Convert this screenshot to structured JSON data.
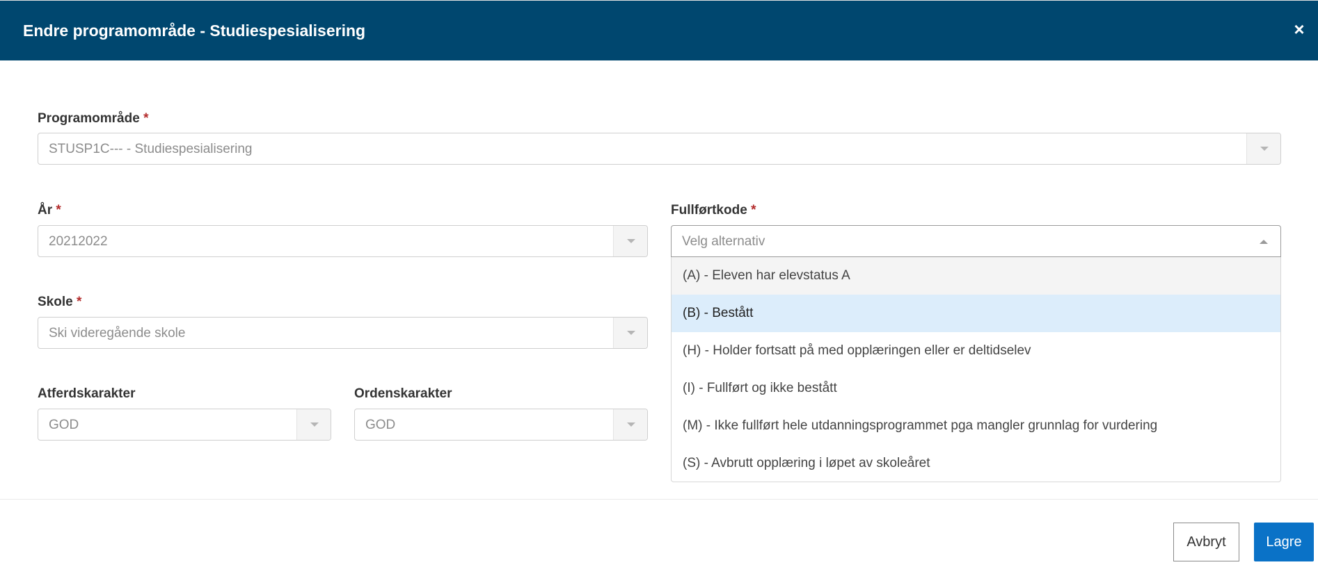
{
  "dialog": {
    "title": "Endre programområde - Studiespesialisering",
    "close_symbol": "×"
  },
  "form": {
    "required_mark": "*",
    "programomrade": {
      "label": "Programområde",
      "value": "STUSP1C--- - Studiespesialisering"
    },
    "ar": {
      "label": "År",
      "value": "20212022"
    },
    "skole": {
      "label": "Skole",
      "value": "Ski videregående skole"
    },
    "atferdskarakter": {
      "label": "Atferdskarakter",
      "value": "GOD"
    },
    "ordenskarakter": {
      "label": "Ordenskarakter",
      "value": "GOD"
    },
    "fullfortkode": {
      "label": "Fullførtkode",
      "placeholder": "Velg alternativ",
      "options": [
        "(A) - Eleven har elevstatus A",
        "(B) - Bestått",
        "(H) - Holder fortsatt på med opplæringen eller er deltidselev",
        "(I) - Fullført og ikke bestått",
        "(M) - Ikke fullført hele utdanningsprogrammet pga mangler grunnlag for vurdering",
        "(S) - Avbrutt opplæring i løpet av skoleåret"
      ]
    }
  },
  "footer": {
    "cancel_label": "Avbryt",
    "save_label": "Lagre"
  },
  "colors": {
    "header_bg": "#00476f",
    "primary_button": "#0a72c7",
    "required": "#b32b2b",
    "selected_option": "#dcedfb"
  }
}
